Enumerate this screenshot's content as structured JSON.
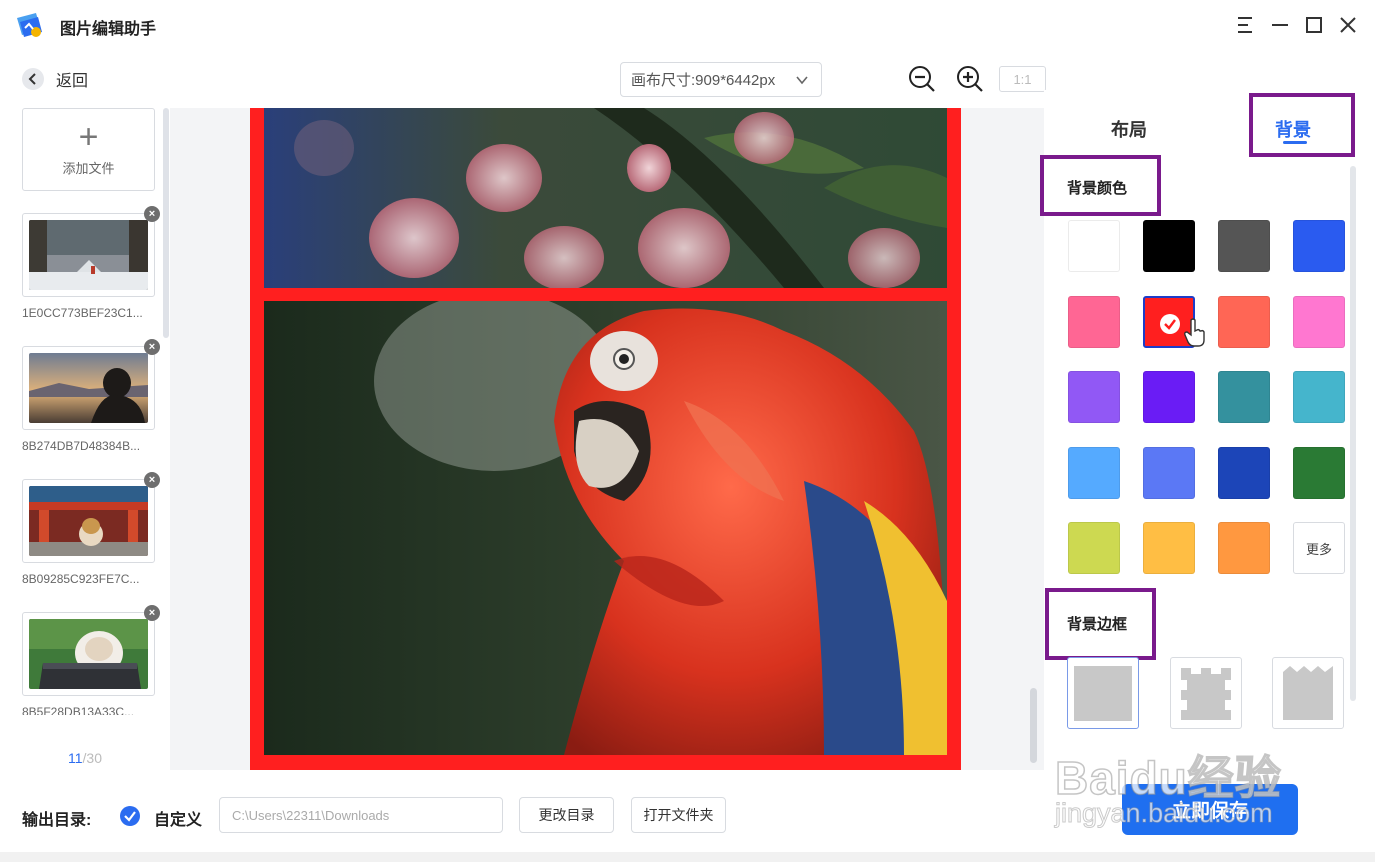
{
  "app": {
    "title": "图片编辑助手"
  },
  "window_controls": [
    "menu-icon",
    "minimize-icon",
    "maximize-icon",
    "close-icon"
  ],
  "toolbar": {
    "back_label": "返回",
    "canvas_size": "画布尺寸:909*6442px",
    "ratio_label": "1:1"
  },
  "file_list": {
    "add_label": "添加文件",
    "items": [
      {
        "name": "1E0CC773BEF23C1..."
      },
      {
        "name": "8B274DB7D48384B..."
      },
      {
        "name": "8B09285C923FE7C..."
      },
      {
        "name": "8B5F28DB13A33C..."
      }
    ],
    "pager": {
      "current": "11",
      "total": "/30"
    }
  },
  "panel": {
    "tabs": {
      "layout": "布局",
      "background": "背景"
    },
    "bg_color_title": "背景颜色",
    "bg_frame_title": "背景边框",
    "more_label": "更多",
    "selected_color": "#ff1f1f",
    "colors": [
      "#ffffff",
      "#000000",
      "#555555",
      "#2a5bf0",
      "#ff6694",
      "#ff1f1f",
      "#ff6655",
      "#ff77d0",
      "#9158f5",
      "#6a1cf5",
      "#34919e",
      "#45b5cc",
      "#55aaff",
      "#5b78f5",
      "#1c45b8",
      "#2a7a34",
      "#cdd951",
      "#ffbe44",
      "#ff9840"
    ]
  },
  "bottom": {
    "output_label": "输出目录:",
    "custom_label": "自定义",
    "path": "C:\\Users\\22311\\Downloads",
    "change_dir": "更改目录",
    "open_folder": "打开文件夹",
    "save": "立即保存"
  },
  "watermark": {
    "main": "Baidu经验",
    "sub": "jingyan.baidu.com"
  },
  "accent_color": "#2b6cf0",
  "highlight_color": "#7a1a8c"
}
